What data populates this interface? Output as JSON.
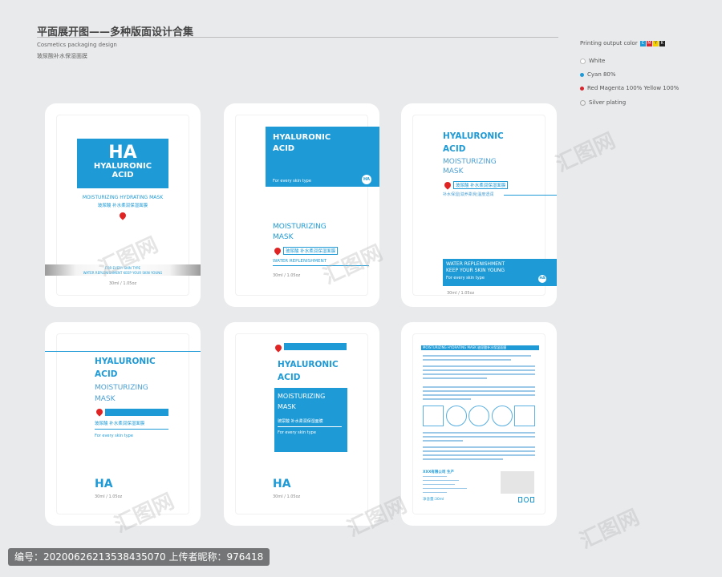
{
  "header": {
    "title": "平面展开图——多种版面设计合集",
    "subtitle": "Cosmetics packaging design",
    "product_cn": "玻尿酸补水保湿面膜"
  },
  "legend": {
    "print_label": "Printing output color",
    "cmyk": [
      "C",
      "M",
      "Y",
      "K"
    ],
    "items": [
      {
        "label": "White",
        "color": "#ffffff"
      },
      {
        "label": "Cyan 80%",
        "color": "#1e9ad6"
      },
      {
        "label": "Red Magenta 100% Yellow 100%",
        "color": "#d9262c"
      },
      {
        "label": "Silver plating",
        "color": "#c8c8c8"
      }
    ]
  },
  "card1": {
    "ha": "HA",
    "title1": "HYALURONIC",
    "title2": "ACID",
    "mask": "MOISTURIZING HYDRATING MASK",
    "cn": "玻尿酸 补水柔润保湿面膜",
    "band1": "FOR EVERY SKIN TYPE",
    "band2": "WATER REPLENISHMENT KEEP YOUR SKIN YOUNG",
    "size": "30ml / 1.05oz"
  },
  "card2": {
    "title1": "HYALURONIC",
    "title2": "ACID",
    "skin": "For every skin type",
    "ha": "HA",
    "mask1": "MOISTURIZING",
    "mask2": "MASK",
    "cn": "玻尿酸 补水柔润保湿面膜",
    "water": "WATER REPLENISHMENT",
    "size": "30ml / 1.05oz"
  },
  "card3": {
    "title1": "HYALURONIC",
    "title2": "ACID",
    "mask1": "MOISTURIZING",
    "mask2": "MASK",
    "cn": "玻尿酸 补水柔润保湿面膜",
    "cn2": "补水保湿|滋养柔滑|温度透润",
    "water": "WATER REPLENISHMENT",
    "keep": "KEEP YOUR SKIN YOUNG",
    "skin": "For every skin type",
    "ha": "HA",
    "size": "30ml / 1.05oz"
  },
  "card4": {
    "title1": "HYALURONIC",
    "title2": "ACID",
    "mask1": "MOISTURIZING",
    "mask2": "MASK",
    "cn": "玻尿酸 补水柔润保湿面膜",
    "skin": "For every skin type",
    "ha": "HA",
    "size": "30ml / 1.05oz"
  },
  "card5": {
    "title1": "HYALURONIC",
    "title2": "ACID",
    "mask1": "MOISTURIZING",
    "mask2": "MASK",
    "cn": "玻尿酸 补水柔润保湿面膜",
    "skin": "For every skin type",
    "ha": "HA",
    "size": "30ml / 1.05oz"
  },
  "card6": {
    "header": "MOISTURIZING HYDRATING MASK",
    "header_cn": "玻尿酸补水保湿面膜",
    "maker": "XXX有限公司 生产",
    "net": "净含量:30ml"
  },
  "footer": {
    "text": "编号：20200626213538435070 上传者昵称：976418"
  },
  "watermark": "汇图网"
}
